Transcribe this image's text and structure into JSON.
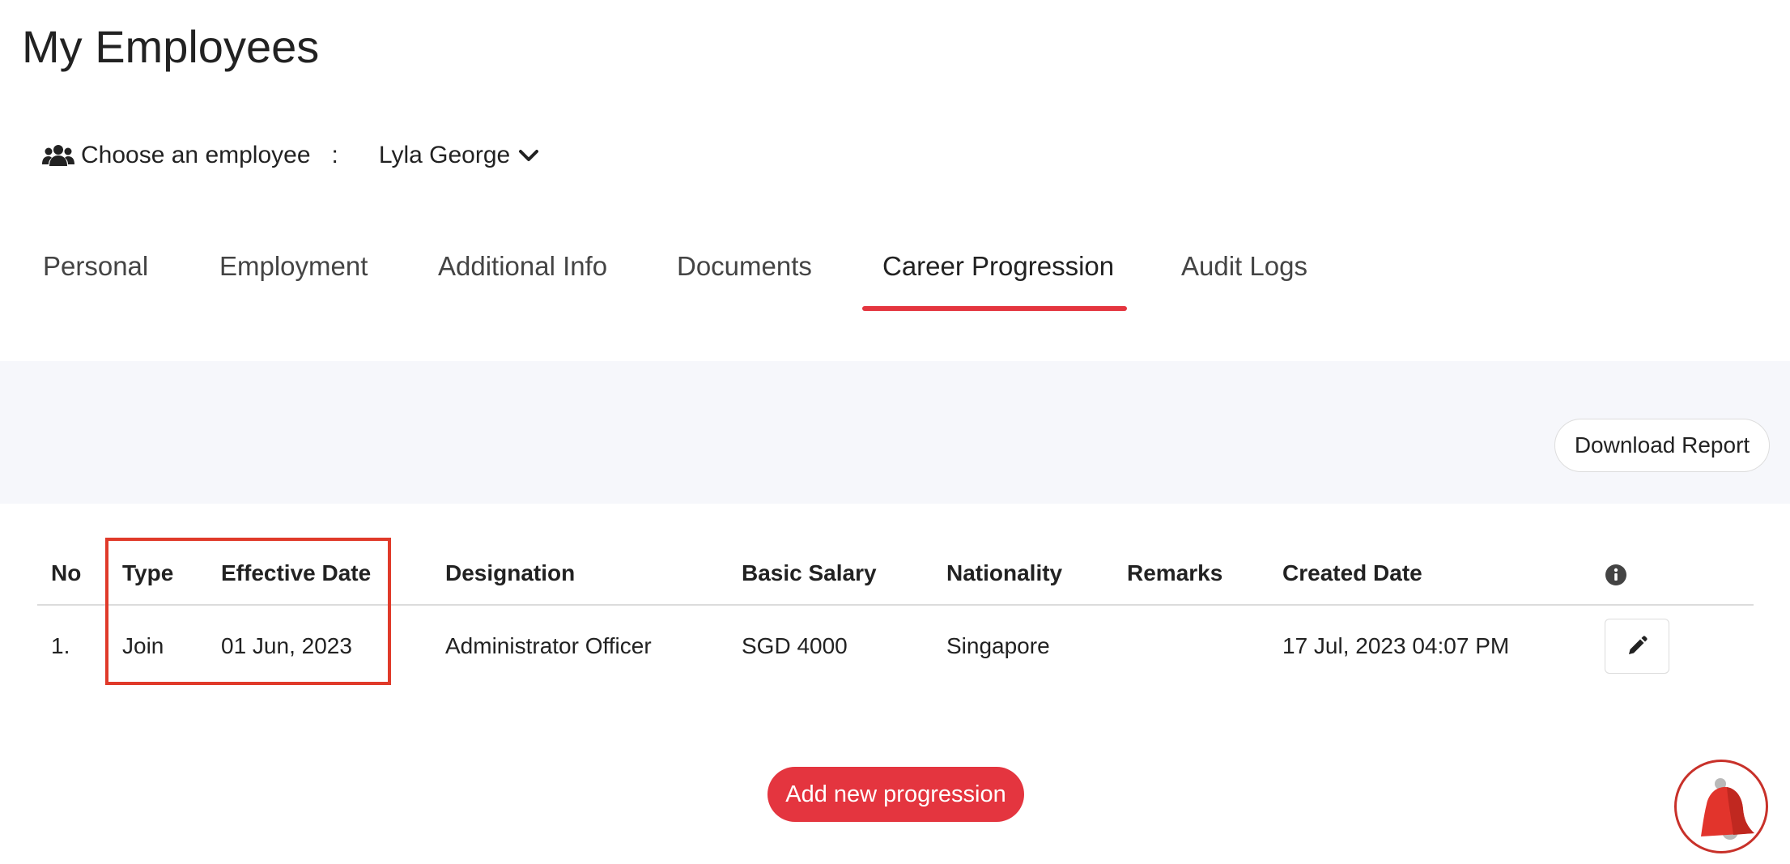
{
  "page": {
    "title": "My Employees"
  },
  "employee_picker": {
    "label": "Choose an employee",
    "separator": ":",
    "selected": "Lyla George",
    "icon": "users-icon"
  },
  "tabs": [
    {
      "label": "Personal",
      "active": false
    },
    {
      "label": "Employment",
      "active": false
    },
    {
      "label": "Additional Info",
      "active": false
    },
    {
      "label": "Documents",
      "active": false
    },
    {
      "label": "Career Progression",
      "active": true
    },
    {
      "label": "Audit Logs",
      "active": false
    }
  ],
  "toolbar": {
    "download_label": "Download Report"
  },
  "table": {
    "headers": [
      "No",
      "Type",
      "Effective Date",
      "Designation",
      "Basic Salary",
      "Nationality",
      "Remarks",
      "Created Date"
    ],
    "info_icon": "info-circle-icon",
    "rows": [
      {
        "no": "1.",
        "type": "Join",
        "effective_date": "01 Jun, 2023",
        "designation": "Administrator Officer",
        "basic_salary": "SGD 4000",
        "nationality": "Singapore",
        "remarks": "",
        "created_date": "17 Jul, 2023 04:07 PM",
        "action_icon": "pencil-icon"
      }
    ]
  },
  "actions": {
    "add_label": "Add new progression"
  },
  "colors": {
    "accent": "#e4353f",
    "band": "#f6f7fb",
    "highlight": "#e03a2a"
  },
  "widgets": {
    "notification_icon": "bell-icon"
  }
}
